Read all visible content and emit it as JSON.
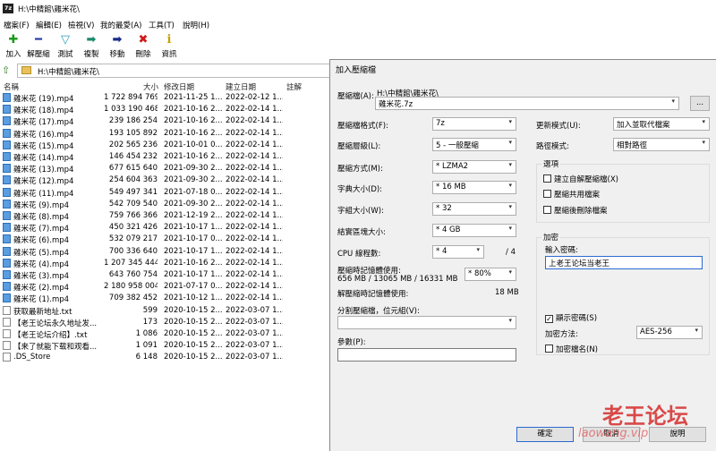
{
  "window_title": "H:\\中精館\\雞米花\\",
  "app_icon_text": "7z",
  "menu": [
    "檔案(F)",
    "編輯(E)",
    "檢視(V)",
    "我的最愛(A)",
    "工具(T)",
    "說明(H)"
  ],
  "toolbar": [
    {
      "label": "加入",
      "icon": "plus-icon",
      "glyph": "✚",
      "color": "#1a9a1a"
    },
    {
      "label": "解壓縮",
      "icon": "minus-icon",
      "glyph": "━",
      "color": "#2a3aa8"
    },
    {
      "label": "測試",
      "icon": "check-icon",
      "glyph": "▽",
      "color": "#2aa0b8"
    },
    {
      "label": "複製",
      "icon": "copy-arrow-icon",
      "glyph": "➡",
      "color": "#1a8a6a"
    },
    {
      "label": "移動",
      "icon": "move-arrow-icon",
      "glyph": "➡",
      "color": "#1a2a8a"
    },
    {
      "label": "刪除",
      "icon": "delete-x-icon",
      "glyph": "✖",
      "color": "#d01a1a"
    },
    {
      "label": "資訊",
      "icon": "info-icon",
      "glyph": "i",
      "color": "#c8a000"
    }
  ],
  "address": "H:\\中精館\\雞米花\\",
  "columns": {
    "name": "名稱",
    "size": "大小",
    "modified": "修改日期",
    "created": "建立日期",
    "comment": "註解"
  },
  "files": [
    {
      "name": "雞米花 (19).mp4",
      "size": "1 722 894 769",
      "modified": "2021-11-25 1...",
      "created": "2022-02-12 1...",
      "type": "video"
    },
    {
      "name": "雞米花 (18).mp4",
      "size": "1 033 190 468",
      "modified": "2021-10-16 2...",
      "created": "2022-02-14 1...",
      "type": "video"
    },
    {
      "name": "雞米花 (17).mp4",
      "size": "239 186 254",
      "modified": "2021-10-16 2...",
      "created": "2022-02-14 1...",
      "type": "video"
    },
    {
      "name": "雞米花 (16).mp4",
      "size": "193 105 892",
      "modified": "2021-10-16 2...",
      "created": "2022-02-14 1...",
      "type": "video"
    },
    {
      "name": "雞米花 (15).mp4",
      "size": "202 565 236",
      "modified": "2021-10-01 0...",
      "created": "2022-02-14 1...",
      "type": "video"
    },
    {
      "name": "雞米花 (14).mp4",
      "size": "146 454 232",
      "modified": "2021-10-16 2...",
      "created": "2022-02-14 1...",
      "type": "video"
    },
    {
      "name": "雞米花 (13).mp4",
      "size": "677 615 640",
      "modified": "2021-09-30 2...",
      "created": "2022-02-14 1...",
      "type": "video"
    },
    {
      "name": "雞米花 (12).mp4",
      "size": "254 604 363",
      "modified": "2021-09-30 2...",
      "created": "2022-02-14 1...",
      "type": "video"
    },
    {
      "name": "雞米花 (11).mp4",
      "size": "549 497 341",
      "modified": "2021-07-18 0...",
      "created": "2022-02-14 1...",
      "type": "video"
    },
    {
      "name": "雞米花 (9).mp4",
      "size": "542 709 540",
      "modified": "2021-09-30 2...",
      "created": "2022-02-14 1...",
      "type": "video"
    },
    {
      "name": "雞米花 (8).mp4",
      "size": "759 766 366",
      "modified": "2021-12-19 2...",
      "created": "2022-02-14 1...",
      "type": "video"
    },
    {
      "name": "雞米花 (7).mp4",
      "size": "450 321 426",
      "modified": "2021-10-17 1...",
      "created": "2022-02-14 1...",
      "type": "video"
    },
    {
      "name": "雞米花 (6).mp4",
      "size": "532 079 217",
      "modified": "2021-10-17 0...",
      "created": "2022-02-14 1...",
      "type": "video"
    },
    {
      "name": "雞米花 (5).mp4",
      "size": "700 336 640",
      "modified": "2021-10-17 1...",
      "created": "2022-02-14 1...",
      "type": "video"
    },
    {
      "name": "雞米花 (4).mp4",
      "size": "1 207 345 444",
      "modified": "2021-10-16 2...",
      "created": "2022-02-14 1...",
      "type": "video"
    },
    {
      "name": "雞米花 (3).mp4",
      "size": "643 760 754",
      "modified": "2021-10-17 1...",
      "created": "2022-02-14 1...",
      "type": "video"
    },
    {
      "name": "雞米花 (2).mp4",
      "size": "2 180 958 004",
      "modified": "2021-07-17 0...",
      "created": "2022-02-14 1...",
      "type": "video"
    },
    {
      "name": "雞米花 (1).mp4",
      "size": "709 382 452",
      "modified": "2021-10-12 1...",
      "created": "2022-02-14 1...",
      "type": "video"
    },
    {
      "name": "获取最新地址.txt",
      "size": "599",
      "modified": "2020-10-15 2...",
      "created": "2022-03-07 1...",
      "type": "text"
    },
    {
      "name": "【老王论坛永久地址发...",
      "size": "173",
      "modified": "2020-10-15 2...",
      "created": "2022-03-07 1...",
      "type": "text"
    },
    {
      "name": "【老王论坛介绍】.txt",
      "size": "1 086",
      "modified": "2020-10-15 2...",
      "created": "2022-03-07 1...",
      "type": "text"
    },
    {
      "name": "【来了就能下载和观看...",
      "size": "1 091",
      "modified": "2020-10-15 2...",
      "created": "2022-03-07 1...",
      "type": "text"
    },
    {
      "name": ".DS_Store",
      "size": "6 148",
      "modified": "2020-10-15 2...",
      "created": "2022-03-07 1...",
      "type": "text"
    }
  ],
  "dialog": {
    "title": "加入壓縮檔",
    "archive_label": "壓縮檔(A):",
    "archive_path": "H:\\中精館\\雞米花\\",
    "archive_name": "雞米花.7z",
    "browse_label": "...",
    "format_label": "壓縮檔格式(F):",
    "format_value": "7z",
    "level_label": "壓縮層級(L):",
    "level_value": "5 - 一般壓縮",
    "method_label": "壓縮方式(M):",
    "method_value": "* LZMA2",
    "dict_label": "字典大小(D):",
    "dict_value": "* 16 MB",
    "word_label": "字組大小(W):",
    "word_value": "* 32",
    "solid_label": "結實區塊大小:",
    "solid_value": "* 4 GB",
    "threads_label": "CPU 線程數:",
    "threads_value": "* 4",
    "threads_max": "/ 4",
    "mem_comp_label": "壓縮時記憶體使用:",
    "mem_comp_value": "656 MB / 13065 MB / 16331 MB",
    "mem_pct": "* 80%",
    "mem_decomp_label": "解壓縮時記憶體使用:",
    "mem_decomp_value": "18 MB",
    "split_label": "分割壓縮檔，位元組(V):",
    "split_value": "",
    "params_label": "參數(P):",
    "params_value": "",
    "update_label": "更新模式(U):",
    "update_value": "加入並取代檔案",
    "path_label": "路徑模式:",
    "path_value": "相對路徑",
    "options_title": "選項",
    "opt_sfx": "建立自解壓縮檔(X)",
    "opt_shared": "壓縮共用檔案",
    "opt_delete": "壓縮後刪除檔案",
    "encrypt_title": "加密",
    "password_label": "輸入密碼:",
    "password_value": "上老王论坛当老王",
    "show_pw": "顯示密碼(S)",
    "enc_method_label": "加密方法:",
    "enc_method_value": "AES-256",
    "enc_names": "加密檔名(N)",
    "ok": "確定",
    "cancel": "取消",
    "help": "說明"
  },
  "watermark": {
    "text1": "老王论坛",
    "text2": "laowang.vip"
  }
}
